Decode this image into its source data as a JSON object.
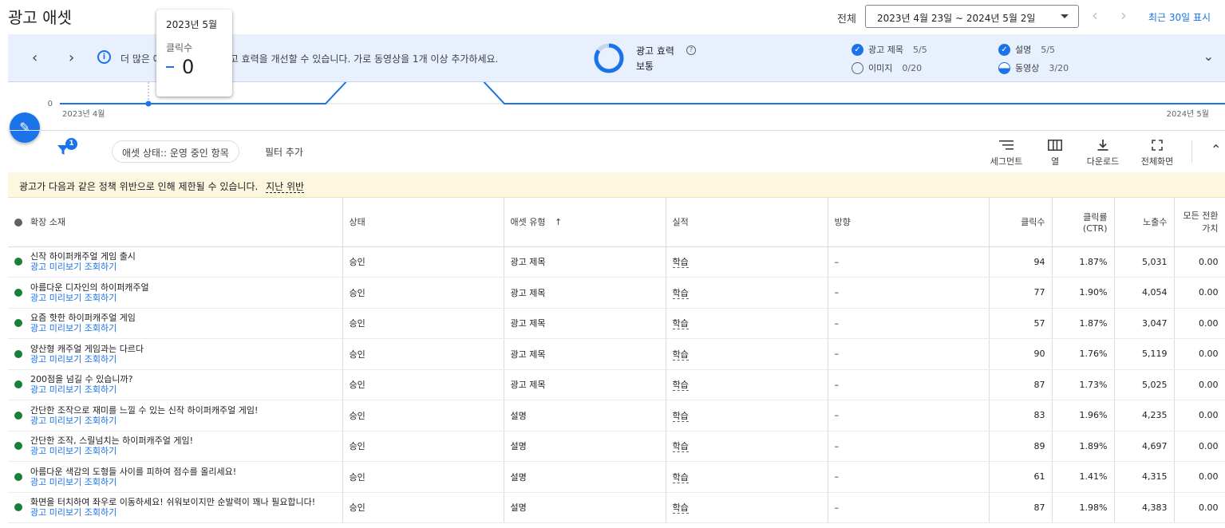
{
  "header": {
    "title": "광고 애셋",
    "scope_label": "전체",
    "date_range": "2023년 4월 23일 ~ 2024년 5월 2일",
    "prev_arrow": "‹",
    "next_arrow": "›",
    "recent_link": "최근 30일 표시"
  },
  "banner": {
    "prev": "‹",
    "next": "›",
    "info_glyph": "i",
    "message": "더 많은 애셋을 추가하여 광고 효력을 개선할 수 있습니다. 가로 동영상을 1개 이상 추가하세요.",
    "ad_strength_label": "광고 효력",
    "help_glyph": "?",
    "ad_strength_value": "보통",
    "ad_strength_fraction": 0.85,
    "asset_checks": [
      {
        "label": "광고 제목",
        "count": "5/5",
        "state": "full"
      },
      {
        "label": "설명",
        "count": "5/5",
        "state": "full"
      },
      {
        "label": "이미지",
        "count": "0/20",
        "state": "empty"
      },
      {
        "label": "동영상",
        "count": "3/20",
        "state": "half"
      }
    ],
    "expand": "⌄",
    "check_glyph": "✓"
  },
  "chart_data": {
    "type": "line",
    "x_start_label": "2023년 4월",
    "x_end_label": "2024년 5월",
    "y_tick_label": "0",
    "series": [
      {
        "name": "클릭수",
        "color": "#1a73e8"
      }
    ],
    "tooltip": {
      "date": "2023년 5월",
      "metric": "클릭수",
      "value": "0"
    }
  },
  "toolbar": {
    "edit_glyph": "✎",
    "filter_badge": "1",
    "filter_chip": "애셋 상태:: 운영 중인 항목",
    "add_filter": "필터 추가",
    "segment": "세그먼트",
    "columns": "열",
    "download": "다운로드",
    "fullscreen": "전체화면",
    "collapse": "⌃"
  },
  "policy": {
    "text": "광고가 다음과 같은 정책 위반으로 인해 제한될 수 있습니다.",
    "link": "지난 위반"
  },
  "table": {
    "headers": {
      "asset": "확장 소재",
      "status": "상태",
      "type": "애셋 유형",
      "sort_arrow": "↑",
      "performance": "실적",
      "direction": "방향",
      "clicks": "클릭수",
      "ctr_line1": "클릭률",
      "ctr_line2": "(CTR)",
      "impressions": "노출수",
      "conv_line1": "모든 전환",
      "conv_line2": "가치"
    },
    "preview_text": "광고 미리보기 조회하기",
    "rows": [
      {
        "asset": "신작 하이퍼캐주얼 게임 출시",
        "status": "승인",
        "type": "광고 제목",
        "perf": "학습",
        "dir": "–",
        "clicks": "94",
        "ctr": "1.87%",
        "impr": "5,031",
        "conv": "0.00"
      },
      {
        "asset": "아름다운 디자인의 하이퍼캐주얼",
        "status": "승인",
        "type": "광고 제목",
        "perf": "학습",
        "dir": "–",
        "clicks": "77",
        "ctr": "1.90%",
        "impr": "4,054",
        "conv": "0.00"
      },
      {
        "asset": "요즘 핫한 하이퍼캐주얼 게임",
        "status": "승인",
        "type": "광고 제목",
        "perf": "학습",
        "dir": "–",
        "clicks": "57",
        "ctr": "1.87%",
        "impr": "3,047",
        "conv": "0.00"
      },
      {
        "asset": "양산형 캐주얼 게임과는 다르다",
        "status": "승인",
        "type": "광고 제목",
        "perf": "학습",
        "dir": "–",
        "clicks": "90",
        "ctr": "1.76%",
        "impr": "5,119",
        "conv": "0.00"
      },
      {
        "asset": "200점을 넘길 수 있습니까?",
        "status": "승인",
        "type": "광고 제목",
        "perf": "학습",
        "dir": "–",
        "clicks": "87",
        "ctr": "1.73%",
        "impr": "5,025",
        "conv": "0.00"
      },
      {
        "asset": "간단한 조작으로 재미를 느낄 수 있는 신작 하이퍼캐주얼 게임!",
        "status": "승인",
        "type": "설명",
        "perf": "학습",
        "dir": "–",
        "clicks": "83",
        "ctr": "1.96%",
        "impr": "4,235",
        "conv": "0.00"
      },
      {
        "asset": "간단한 조작, 스릴넘치는 하이퍼캐주얼 게임!",
        "status": "승인",
        "type": "설명",
        "perf": "학습",
        "dir": "–",
        "clicks": "89",
        "ctr": "1.89%",
        "impr": "4,697",
        "conv": "0.00"
      },
      {
        "asset": "아름다운 색감의 도형들 사이를 피하여 점수를 올리세요!",
        "status": "승인",
        "type": "설명",
        "perf": "학습",
        "dir": "–",
        "clicks": "61",
        "ctr": "1.41%",
        "impr": "4,315",
        "conv": "0.00"
      },
      {
        "asset": "화면을 터치하여 좌우로 이동하세요! 쉬워보이지만 순발력이 꽤나 필요합니다!",
        "status": "승인",
        "type": "설명",
        "perf": "학습",
        "dir": "–",
        "clicks": "87",
        "ctr": "1.98%",
        "impr": "4,383",
        "conv": "0.00"
      }
    ]
  }
}
